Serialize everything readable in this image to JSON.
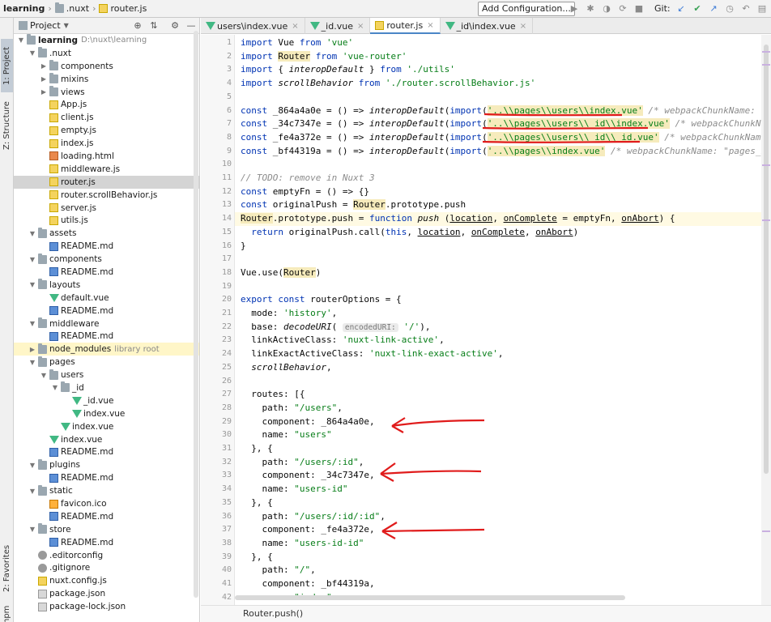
{
  "topbar": {
    "crumbs": [
      "learning",
      ".nuxt",
      "router.js"
    ],
    "add_configuration": "Add Configuration...",
    "git_label": "Git:"
  },
  "sidetabs": {
    "project": "1: Project",
    "structure": "Z: Structure",
    "favorites": "2: Favorites",
    "npm": "npm"
  },
  "project_panel": {
    "title": "Project",
    "tree": [
      {
        "label": "learning",
        "extra": "D:\\nuxt\\learning",
        "depth": 0,
        "type": "folder",
        "arrow": "open",
        "bold": true
      },
      {
        "label": ".nuxt",
        "depth": 1,
        "type": "folder",
        "arrow": "open"
      },
      {
        "label": "components",
        "depth": 2,
        "type": "folder",
        "arrow": "closed"
      },
      {
        "label": "mixins",
        "depth": 2,
        "type": "folder",
        "arrow": "closed"
      },
      {
        "label": "views",
        "depth": 2,
        "type": "folder",
        "arrow": "closed"
      },
      {
        "label": "App.js",
        "depth": 2,
        "type": "js"
      },
      {
        "label": "client.js",
        "depth": 2,
        "type": "js"
      },
      {
        "label": "empty.js",
        "depth": 2,
        "type": "js"
      },
      {
        "label": "index.js",
        "depth": 2,
        "type": "js"
      },
      {
        "label": "loading.html",
        "depth": 2,
        "type": "html"
      },
      {
        "label": "middleware.js",
        "depth": 2,
        "type": "js"
      },
      {
        "label": "router.js",
        "depth": 2,
        "type": "js",
        "selected": true
      },
      {
        "label": "router.scrollBehavior.js",
        "depth": 2,
        "type": "js"
      },
      {
        "label": "server.js",
        "depth": 2,
        "type": "js"
      },
      {
        "label": "utils.js",
        "depth": 2,
        "type": "js"
      },
      {
        "label": "assets",
        "depth": 1,
        "type": "folder",
        "arrow": "open"
      },
      {
        "label": "README.md",
        "depth": 2,
        "type": "md"
      },
      {
        "label": "components",
        "depth": 1,
        "type": "folder",
        "arrow": "open"
      },
      {
        "label": "README.md",
        "depth": 2,
        "type": "md"
      },
      {
        "label": "layouts",
        "depth": 1,
        "type": "folder",
        "arrow": "open"
      },
      {
        "label": "default.vue",
        "depth": 2,
        "type": "vue"
      },
      {
        "label": "README.md",
        "depth": 2,
        "type": "md"
      },
      {
        "label": "middleware",
        "depth": 1,
        "type": "folder",
        "arrow": "open"
      },
      {
        "label": "README.md",
        "depth": 2,
        "type": "md"
      },
      {
        "label": "node_modules",
        "extra": "library root",
        "depth": 1,
        "type": "folder",
        "arrow": "closed",
        "library": true
      },
      {
        "label": "pages",
        "depth": 1,
        "type": "folder",
        "arrow": "open"
      },
      {
        "label": "users",
        "depth": 2,
        "type": "folder",
        "arrow": "open"
      },
      {
        "label": "_id",
        "depth": 3,
        "type": "folder",
        "arrow": "open"
      },
      {
        "label": "_id.vue",
        "depth": 4,
        "type": "vue"
      },
      {
        "label": "index.vue",
        "depth": 4,
        "type": "vue"
      },
      {
        "label": "index.vue",
        "depth": 3,
        "type": "vue"
      },
      {
        "label": "index.vue",
        "depth": 2,
        "type": "vue"
      },
      {
        "label": "README.md",
        "depth": 2,
        "type": "md"
      },
      {
        "label": "plugins",
        "depth": 1,
        "type": "folder",
        "arrow": "open"
      },
      {
        "label": "README.md",
        "depth": 2,
        "type": "md"
      },
      {
        "label": "static",
        "depth": 1,
        "type": "folder",
        "arrow": "open"
      },
      {
        "label": "favicon.ico",
        "depth": 2,
        "type": "ico"
      },
      {
        "label": "README.md",
        "depth": 2,
        "type": "md"
      },
      {
        "label": "store",
        "depth": 1,
        "type": "folder",
        "arrow": "open"
      },
      {
        "label": "README.md",
        "depth": 2,
        "type": "md"
      },
      {
        "label": ".editorconfig",
        "depth": 1,
        "type": "gear"
      },
      {
        "label": ".gitignore",
        "depth": 1,
        "type": "gear"
      },
      {
        "label": "nuxt.config.js",
        "depth": 1,
        "type": "js"
      },
      {
        "label": "package.json",
        "depth": 1,
        "type": "json"
      },
      {
        "label": "package-lock.json",
        "depth": 1,
        "type": "json"
      }
    ]
  },
  "editor": {
    "tabs": [
      {
        "label": "users\\index.vue",
        "type": "vue"
      },
      {
        "label": "_id.vue",
        "type": "vue"
      },
      {
        "label": "router.js",
        "type": "js",
        "active": true
      },
      {
        "label": "_id\\index.vue",
        "type": "vue"
      }
    ],
    "code": [
      [
        [
          "kw",
          "import "
        ],
        [
          "",
          "Vue "
        ],
        [
          "kw",
          "from "
        ],
        [
          "st",
          "'vue'"
        ]
      ],
      [
        [
          "kw",
          "import "
        ],
        [
          "hl",
          "Router"
        ],
        [
          "",
          ""
        ],
        [
          "kw",
          " from "
        ],
        [
          "st",
          "'vue-router'"
        ]
      ],
      [
        [
          "kw",
          "import "
        ],
        [
          "",
          "{ "
        ],
        [
          "it",
          "interopDefault"
        ],
        [
          "",
          " } "
        ],
        [
          "kw",
          "from "
        ],
        [
          "st",
          "'./utils'"
        ]
      ],
      [
        [
          "kw",
          "import "
        ],
        [
          "it",
          "scrollBehavior "
        ],
        [
          "kw",
          "from "
        ],
        [
          "st",
          "'./router.scrollBehavior.js'"
        ]
      ],
      [],
      [
        [
          "kw",
          "const "
        ],
        [
          "",
          "_864a4a0e = () => "
        ],
        [
          "it",
          "interopDefault"
        ],
        [
          "",
          "("
        ],
        [
          "kw",
          "import"
        ],
        [
          "",
          "("
        ],
        [
          "st hl",
          "'..\\\\pages\\\\users\\\\index.vue'"
        ],
        [
          "cm",
          " /* webpackChunkName: \"pages_users\" */"
        ]
      ],
      [
        [
          "kw",
          "const "
        ],
        [
          "",
          "_34c7347e = () => "
        ],
        [
          "it",
          "interopDefault"
        ],
        [
          "",
          "("
        ],
        [
          "kw",
          "import"
        ],
        [
          "",
          "("
        ],
        [
          "st hl",
          "'..\\\\pages\\\\users\\\\_id\\\\index.vue'"
        ],
        [
          "cm",
          " /* webpackChunkName: \"pages_users__id\" */"
        ]
      ],
      [
        [
          "kw",
          "const "
        ],
        [
          "",
          "_fe4a372e = () => "
        ],
        [
          "it",
          "interopDefault"
        ],
        [
          "",
          "("
        ],
        [
          "kw",
          "import"
        ],
        [
          "",
          "("
        ],
        [
          "st hl",
          "'..\\\\pages\\\\users\\\\_id\\\\_id.vue'"
        ],
        [
          "cm",
          " /* webpackChunkName: \"pages_users__id__id\" */"
        ]
      ],
      [
        [
          "kw",
          "const "
        ],
        [
          "",
          "_bf44319a = () => "
        ],
        [
          "it",
          "interopDefault"
        ],
        [
          "",
          "("
        ],
        [
          "kw",
          "import"
        ],
        [
          "",
          "("
        ],
        [
          "st hl",
          "'..\\\\pages\\\\index.vue'"
        ],
        [
          "cm",
          " /* webpackChunkName: \"pages_index\" */"
        ]
      ],
      [],
      [
        [
          "cm",
          "// TODO: remove in Nuxt 3"
        ]
      ],
      [
        [
          "kw",
          "const "
        ],
        [
          "",
          "emptyFn = () => {}"
        ]
      ],
      [
        [
          "kw",
          "const "
        ],
        [
          "",
          "originalPush = "
        ],
        [
          "hl",
          "Router"
        ],
        [
          "",
          ".prototype.push"
        ]
      ],
      [
        [
          "hl",
          "Router"
        ],
        [
          "",
          ".prototype.push = "
        ],
        [
          "kw",
          "function "
        ],
        [
          "it",
          "push "
        ],
        [
          "",
          "("
        ],
        [
          "ud",
          "location"
        ],
        [
          "",
          ", "
        ],
        [
          "ud",
          "onComplete"
        ],
        [
          "",
          " = emptyFn, "
        ],
        [
          "ud",
          "onAbort"
        ],
        [
          "",
          ") {"
        ]
      ],
      [
        [
          "",
          "  "
        ],
        [
          "kw",
          "return "
        ],
        [
          "",
          "originalPush.call("
        ],
        [
          "kw",
          "this"
        ],
        [
          "",
          ", "
        ],
        [
          "ud",
          "location"
        ],
        [
          "",
          ", "
        ],
        [
          "ud",
          "onComplete"
        ],
        [
          "",
          ", "
        ],
        [
          "ud",
          "onAbort"
        ],
        [
          "",
          ")"
        ]
      ],
      [
        [
          "",
          "}"
        ]
      ],
      [],
      [
        [
          "",
          "Vue.use("
        ],
        [
          "hl",
          "Router"
        ],
        [
          "",
          ")"
        ]
      ],
      [],
      [
        [
          "kw",
          "export const "
        ],
        [
          "",
          "routerOptions = {"
        ]
      ],
      [
        [
          "",
          "  mode: "
        ],
        [
          "st",
          "'history'"
        ],
        [
          "",
          ","
        ]
      ],
      [
        [
          "",
          "  base: "
        ],
        [
          "it",
          "decodeURI"
        ],
        [
          "",
          "( "
        ],
        [
          "hint",
          "encodedURI:"
        ],
        [
          " ",
          ""
        ],
        [
          "st",
          " '/'"
        ],
        [
          "",
          "),"
        ]
      ],
      [
        [
          "",
          "  linkActiveClass: "
        ],
        [
          "st",
          "'nuxt-link-active'"
        ],
        [
          "",
          ","
        ]
      ],
      [
        [
          "",
          "  linkExactActiveClass: "
        ],
        [
          "st",
          "'nuxt-link-exact-active'"
        ],
        [
          "",
          ","
        ]
      ],
      [
        [
          "",
          "  "
        ],
        [
          "it",
          "scrollBehavior"
        ],
        [
          "",
          ","
        ]
      ],
      [],
      [
        [
          "",
          "  routes: [{"
        ]
      ],
      [
        [
          "",
          "    path: "
        ],
        [
          "st",
          "\"/users\""
        ],
        [
          "",
          ","
        ]
      ],
      [
        [
          "",
          "    component: _864a4a0e,"
        ]
      ],
      [
        [
          "",
          "    name: "
        ],
        [
          "st",
          "\"users\""
        ]
      ],
      [
        [
          "",
          "  }, {"
        ]
      ],
      [
        [
          "",
          "    path: "
        ],
        [
          "st",
          "\"/users/:id\""
        ],
        [
          "",
          ","
        ]
      ],
      [
        [
          "",
          "    component: _34c7347e,"
        ]
      ],
      [
        [
          "",
          "    name: "
        ],
        [
          "st",
          "\"users-id\""
        ]
      ],
      [
        [
          "",
          "  }, {"
        ]
      ],
      [
        [
          "",
          "    path: "
        ],
        [
          "st",
          "\"/users/:id/:id\""
        ],
        [
          "",
          ","
        ]
      ],
      [
        [
          "",
          "    component: _fe4a372e,"
        ]
      ],
      [
        [
          "",
          "    name: "
        ],
        [
          "st",
          "\"users-id-id\""
        ]
      ],
      [
        [
          "",
          "  }, {"
        ]
      ],
      [
        [
          "",
          "    path: "
        ],
        [
          "st",
          "\"/\""
        ],
        [
          "",
          ","
        ]
      ],
      [
        [
          "",
          "    component: _bf44319a,"
        ]
      ],
      [
        [
          "",
          "    name: "
        ],
        [
          "st",
          "\"index\""
        ]
      ]
    ],
    "breadcrumb": "Router.push()",
    "annotation_color": "#e01b1b"
  }
}
